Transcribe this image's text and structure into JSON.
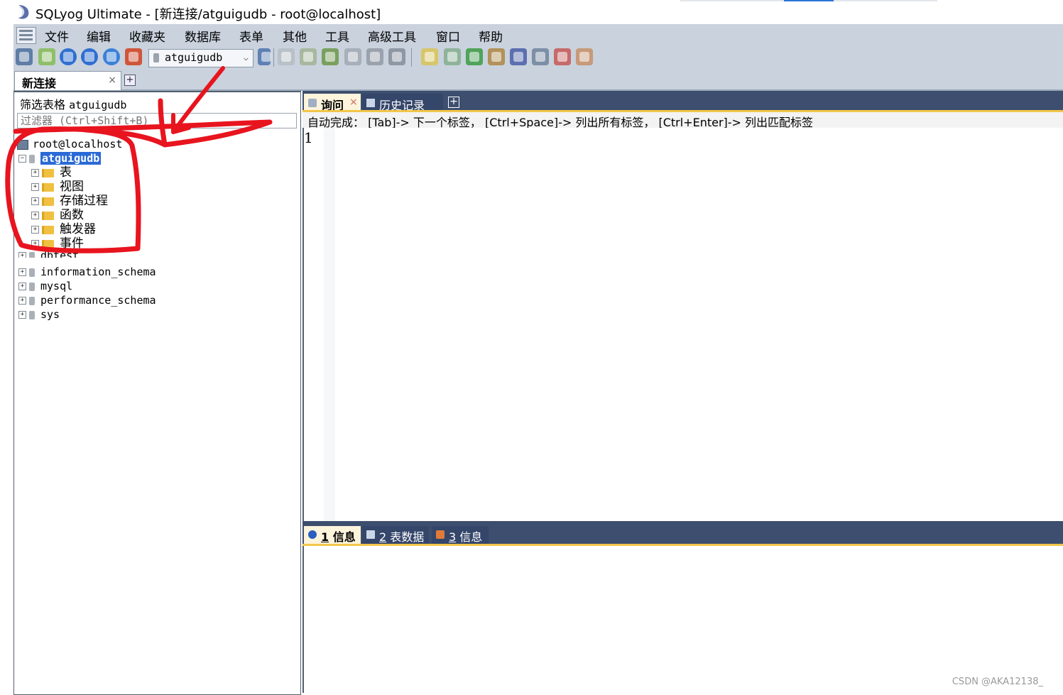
{
  "window": {
    "title": "SQLyog Ultimate - [新连接/atguigudb - root@localhost]"
  },
  "menu": {
    "items": [
      "文件",
      "编辑",
      "收藏夹",
      "数据库",
      "表单",
      "其他",
      "工具",
      "高级工具",
      "窗口",
      "帮助"
    ]
  },
  "toolbar": {
    "database_selector": "atguigudb"
  },
  "connection_tab": {
    "label": "新连接",
    "close": "×",
    "add": "+"
  },
  "sidebar": {
    "filter_label": "筛选表格",
    "filter_db": "atguigudb",
    "filter_placeholder": "过滤器 (Ctrl+Shift+B)",
    "server": "root@localhost",
    "selected_db": "atguigudb",
    "children": [
      "表",
      "视图",
      "存储过程",
      "函数",
      "触发器",
      "事件"
    ],
    "partial_db": "dbtest",
    "databases": [
      "information_schema",
      "mysql",
      "performance_schema",
      "sys"
    ]
  },
  "query_tabs": {
    "query": "询问",
    "history": "历史记录",
    "close": "×",
    "add": "+"
  },
  "hint": "自动完成： [Tab]-> 下一个标签， [Ctrl+Space]-> 列出所有标签， [Ctrl+Enter]-> 列出匹配标签",
  "editor": {
    "line_number": "1"
  },
  "result_tabs": [
    {
      "num": "1",
      "label": "信息"
    },
    {
      "num": "2",
      "label": "表数据"
    },
    {
      "num": "3",
      "label": "信息"
    }
  ],
  "watermark": "CSDN @AKA12138_",
  "colors": {
    "toolbar_bg": "#c9d2dd",
    "tab_bar_bg": "#3d4e6e",
    "active_tab": "#fdf4dc",
    "accent_underline": "#f2c64a",
    "selection": "#2a6ad6",
    "annotation_red": "#e8141e"
  }
}
